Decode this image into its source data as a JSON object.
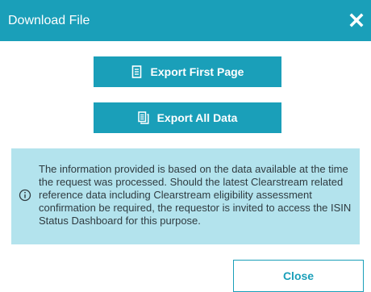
{
  "dialog": {
    "title": "Download File",
    "close_icon": "close-icon"
  },
  "buttons": {
    "export_first_page": {
      "label": "Export First Page",
      "icon": "document-icon"
    },
    "export_all_data": {
      "label": "Export All Data",
      "icon": "documents-icon"
    },
    "close": {
      "label": "Close"
    }
  },
  "info": {
    "icon": "info-icon",
    "text": "The information provided is based on the data available at the time the request was processed. Should the latest Clearstream related reference data including Clearstream eligibility assessment confirmation be required, the requestor is invited to access the ISIN Status Dashboard for this purpose."
  },
  "colors": {
    "accent": "#1a9fb9",
    "info_background": "#b3e3ed",
    "text": "#2f3b40"
  }
}
